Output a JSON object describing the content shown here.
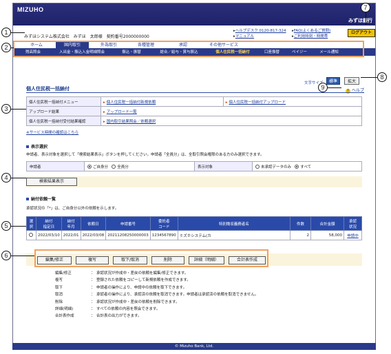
{
  "app": {
    "logo": "MIZUHO",
    "bank": "みずほ銀行"
  },
  "user": {
    "company": "みずほシステム株式会社",
    "name": "みずほ　太郎様",
    "contract": "契約番号2000000000"
  },
  "header_links": {
    "helpdesk": "ヘルプデスク 0120-817-324",
    "manual": "マニュアル",
    "faq": "FAQ(よくあるご質問)",
    "faq2": "ご利用時刻・時間帯",
    "logout": "ログアウト"
  },
  "nav_main": [
    {
      "label": "ホーム",
      "active": false
    },
    {
      "label": "国内取引",
      "active": true
    },
    {
      "label": "外為取引",
      "active": false
    },
    {
      "label": "各種管理",
      "active": false
    },
    {
      "label": "承認",
      "active": false
    },
    {
      "label": "その他サービス",
      "active": false
    }
  ],
  "nav_sub": [
    {
      "label": "残高照会",
      "active": false
    },
    {
      "label": "入出金・振込入金明細照会",
      "active": false
    },
    {
      "label": "振込・振替",
      "active": false
    },
    {
      "label": "総合／給与・賞与振込",
      "active": false
    },
    {
      "label": "個人住民税一括納付",
      "active": true
    },
    {
      "label": "口座振替",
      "active": false
    },
    {
      "label": "ペイジー",
      "active": false
    },
    {
      "label": "メール通知",
      "active": false
    }
  ],
  "page": {
    "title": "個人住民税一括納付",
    "font_size_label": "文字サイズ",
    "font_std": "標準",
    "font_big": "拡大",
    "help": "ヘルプ"
  },
  "menu": [
    {
      "label": "個人住民税一括納付メニュー",
      "links": [
        "個人住民税一括納付新規依頼",
        "個人住民税一括納付アップロード"
      ]
    },
    {
      "label": "アップロード結果",
      "links": [
        "アップロード一覧"
      ]
    },
    {
      "label": "個人住民税一括納付受付結果確認",
      "links": [
        "国内取引結果照会／依頼選択"
      ]
    }
  ],
  "service_link": "※サービス時間の確認はこちら",
  "display_select": {
    "title": "表示選択",
    "desc": "申請者、表示対象を選択して「検索結果表示」ボタンを押してください。申請者「全員分」は、全取引照会権限のある方のみ選択できます。",
    "applicant_label": "申請者",
    "applicant_options": [
      "ご自身分",
      "全員分"
    ],
    "target_label": "表示対象",
    "target_options": [
      "未承認データのみ",
      "すべて"
    ],
    "search_button": "検索結果表示"
  },
  "result": {
    "title": "納付依頼一覧",
    "desc": "承認状況の「*」は、ご自身分以外の依頼を示します。",
    "columns": [
      "選択",
      "納付\n指定日",
      "納付\n年月",
      "依頼日",
      "申請番号",
      "委託者\nコード",
      "特別徴収義務者名",
      "件数",
      "合計金額",
      "承認\n状況"
    ],
    "rows": [
      {
        "date": "2022/03/10",
        "ym": "2022/01",
        "req_date": "2022/03/08",
        "app_no": "20211208250000003",
        "code": "1234567890",
        "name": "ミズホシステム(カ",
        "count": "2",
        "amount": "58,000",
        "status": "申請中"
      }
    ]
  },
  "actions": [
    "編集/修正",
    "複写",
    "取下/取消",
    "削除",
    "詳細（明細）",
    "合計表作成"
  ],
  "legend": [
    {
      "term": "編集/修正",
      "desc": "承認状況が作成中・差戻の依頼を編集/修正できます。"
    },
    {
      "term": "複写",
      "desc": "登録された依頼をコピーして新規依頼を作成できます。"
    },
    {
      "term": "取下",
      "desc": "申請者の操作により、申請中の依頼を取下できます。"
    },
    {
      "term": "取消",
      "desc": "承認者の操作により、承認済の依頼を取消できます。申請者は承認済の依頼を取消できません。"
    },
    {
      "term": "削除",
      "desc": "承認状況が作成中・差戻の依頼を削除できます。"
    },
    {
      "term": "詳細(明細)",
      "desc": "すべての依頼の内容を照会できます。"
    },
    {
      "term": "合計表作成",
      "desc": "合計表の出力ができます。"
    }
  ],
  "footer": "© Mizuho Bank, Ltd.",
  "callouts": [
    "1",
    "2",
    "3",
    "4",
    "5",
    "6",
    "7",
    "8",
    "9"
  ]
}
